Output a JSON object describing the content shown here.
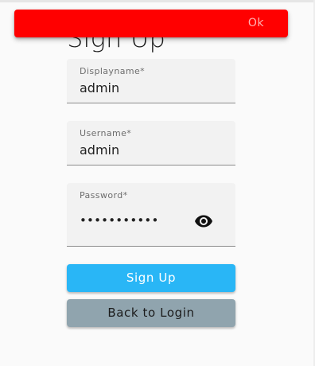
{
  "page": {
    "title": "Sign Up"
  },
  "snackbar": {
    "action_label": "Ok",
    "color": "#ff0000"
  },
  "form": {
    "displayname": {
      "label": "Displayname*",
      "value": "admin"
    },
    "username": {
      "label": "Username*",
      "value": "admin"
    },
    "password": {
      "label": "Password*",
      "masked_value": "•••••••••••",
      "toggle_icon": "eye-icon"
    }
  },
  "buttons": {
    "signup_label": "Sign Up",
    "back_label": "Back to Login",
    "signup_color": "#29b6f6",
    "back_color": "#90a4ae"
  }
}
